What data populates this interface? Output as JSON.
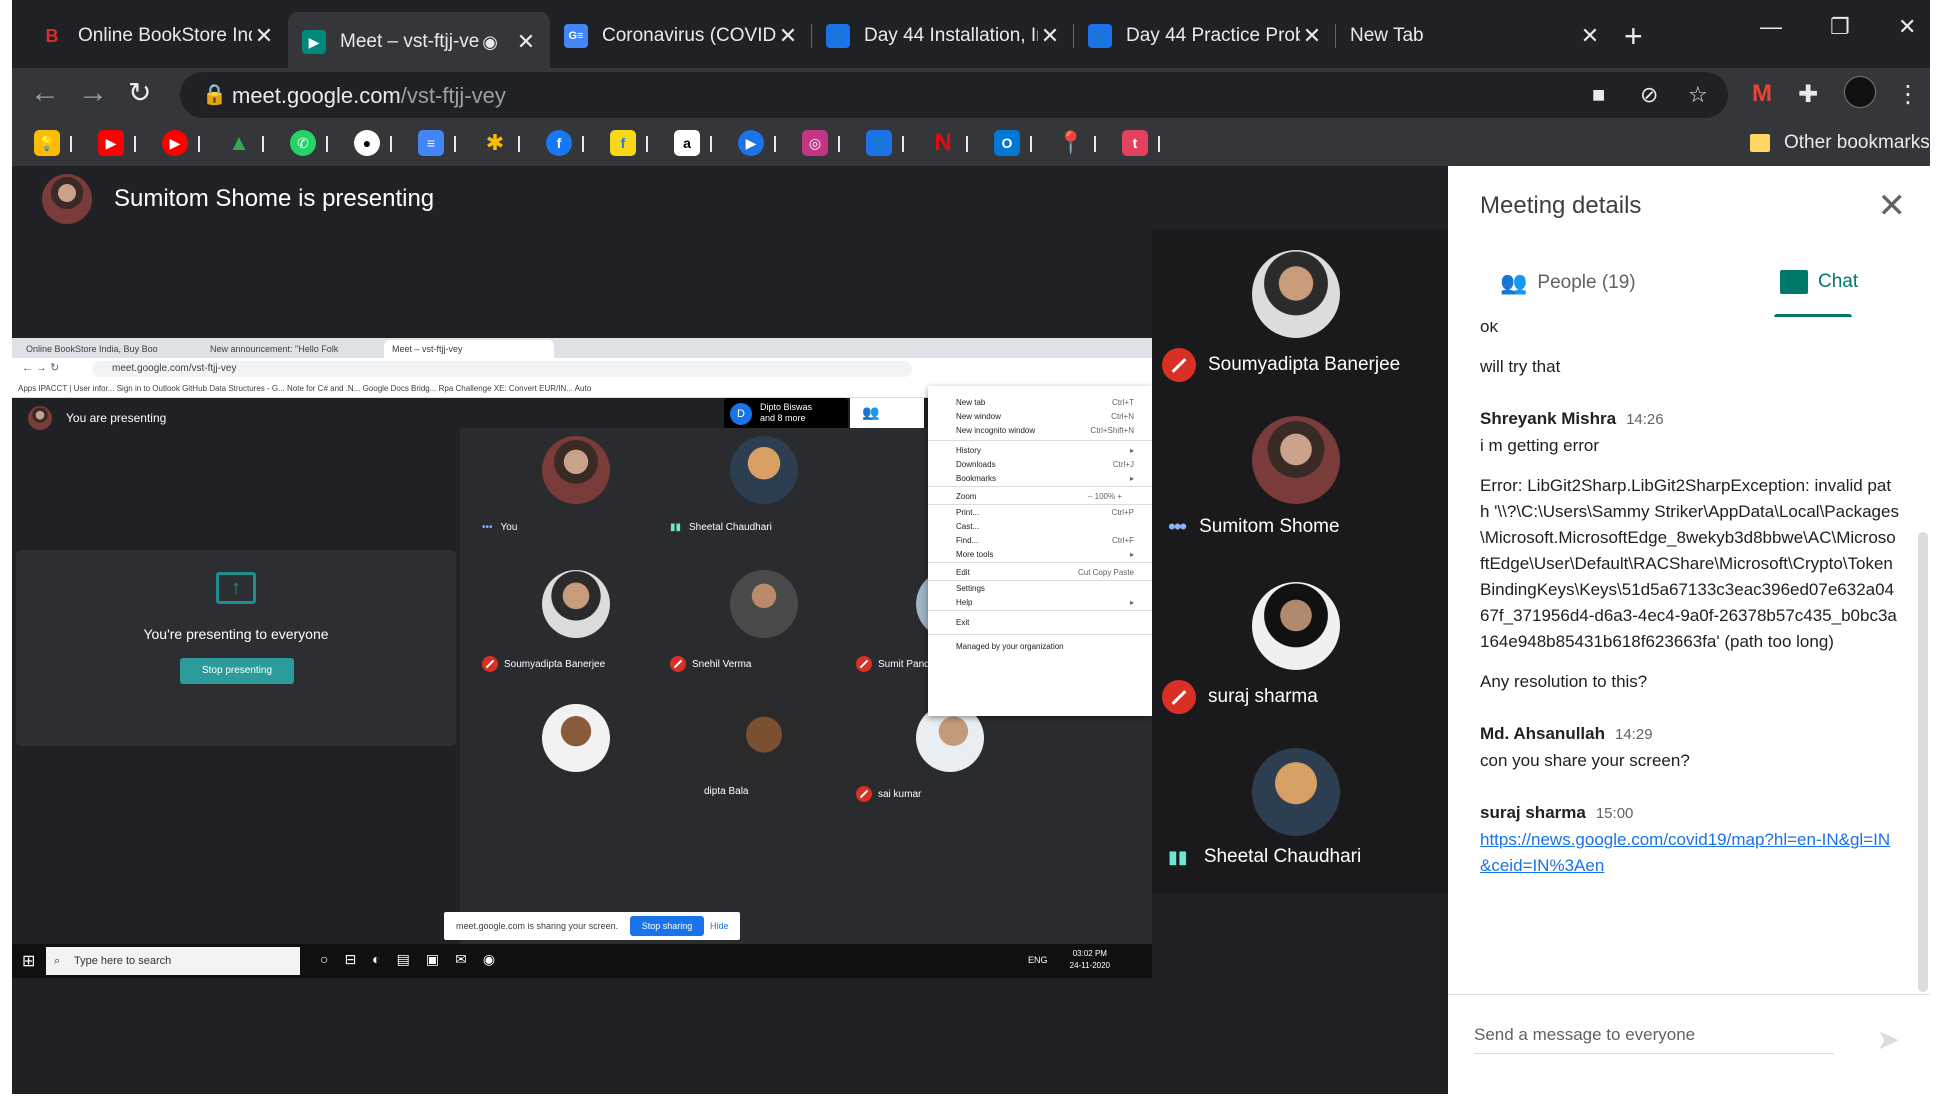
{
  "tabs": [
    {
      "title": "Online BookStore Ind",
      "favicon": "B",
      "fav_color": "#d32f2f",
      "active": false
    },
    {
      "title": "Meet – vst-ftjj-ve",
      "favicon": "M",
      "fav_color": "#00897b",
      "active": true
    },
    {
      "title": "Coronavirus (COVID-",
      "favicon": "G",
      "fav_color": "#4285f4",
      "active": false
    },
    {
      "title": "Day 44 Installation, Ir",
      "favicon": "C",
      "fav_color": "#1a73e8",
      "active": false
    },
    {
      "title": "Day 44 Practice Prob",
      "favicon": "C",
      "fav_color": "#1a73e8",
      "active": false
    },
    {
      "title": "New Tab",
      "favicon": "",
      "fav_color": "",
      "active": false
    }
  ],
  "address": {
    "domain": "meet.google.com",
    "path": "/vst-ftjj-vey"
  },
  "bookmarks": {
    "other_label": "Other bookmarks"
  },
  "presenter": {
    "label": "Sumitom Shome is presenting"
  },
  "shared_screen": {
    "tabs": [
      "Online BookStore India, Buy Boo",
      "New announcement: \"Hello Folk",
      "Meet – vst-ftjj-vey"
    ],
    "url": "meet.google.com/vst-ftjj-vey",
    "bookmarks_bar": "Apps   IPACCT | User infor...   Sign in to Outlook   GitHub   Data Structures - G...   Note for C# and .N...   Google Docs Bridg...   Rpa Challenge   XE: Convert EUR/IN...   Auto",
    "you_presenting": "You are presenting",
    "pill_name": "Dipto Biswas",
    "pill_more": "and 8 more",
    "presenting_text": "You're presenting to everyone",
    "stop_label": "Stop presenting",
    "participants": [
      {
        "name": "You",
        "state": "dots"
      },
      {
        "name": "Sheetal Chaudhari",
        "state": "speaking"
      },
      {
        "name": "Soumyadipta Banerjee",
        "state": "muted"
      },
      {
        "name": "Snehil Verma",
        "state": "muted"
      },
      {
        "name": "Sumit Pandit",
        "state": "muted"
      },
      {
        "name": "",
        "state": "none"
      },
      {
        "name": "dipta Bala",
        "state": "none"
      },
      {
        "name": "sai kumar",
        "state": "muted"
      }
    ],
    "menu": {
      "items": [
        {
          "label": "New tab",
          "shortcut": "Ctrl+T"
        },
        {
          "label": "New window",
          "shortcut": "Ctrl+N"
        },
        {
          "label": "New incognito window",
          "shortcut": "Ctrl+Shift+N"
        },
        {
          "label": "History",
          "shortcut": "▸"
        },
        {
          "label": "Downloads",
          "shortcut": "Ctrl+J"
        },
        {
          "label": "Bookmarks",
          "shortcut": "▸"
        },
        {
          "label": "Zoom",
          "shortcut": "–   100%   +"
        },
        {
          "label": "Print...",
          "shortcut": "Ctrl+P"
        },
        {
          "label": "Cast...",
          "shortcut": ""
        },
        {
          "label": "Find...",
          "shortcut": "Ctrl+F"
        },
        {
          "label": "More tools",
          "shortcut": "▸"
        },
        {
          "label": "Edit",
          "shortcut": "Cut   Copy   Paste"
        },
        {
          "label": "Settings",
          "shortcut": ""
        },
        {
          "label": "Help",
          "shortcut": "▸"
        },
        {
          "label": "Exit",
          "shortcut": ""
        },
        {
          "label": "Managed by your organization",
          "shortcut": ""
        }
      ]
    },
    "share_notice": "meet.google.com is sharing your screen.",
    "share_stop": "Stop sharing",
    "share_hide": "Hide",
    "taskbar_search": "Type here to search",
    "clock_time": "03:02 PM",
    "clock_date": "24-11-2020",
    "lang": "ENG"
  },
  "tiles": [
    {
      "name": "Soumyadipta Banerjee",
      "state": "muted"
    },
    {
      "name": "Sumitom Shome",
      "state": "dots"
    },
    {
      "name": "suraj sharma",
      "state": "muted"
    },
    {
      "name": "Sheetal Chaudhari",
      "state": "speaking"
    }
  ],
  "sidebar": {
    "title": "Meeting details",
    "people_label": "People (19)",
    "chat_label": "Chat",
    "messages": [
      {
        "sender": "",
        "time": "",
        "lines": [
          "ok"
        ]
      },
      {
        "sender": "",
        "time": "",
        "lines": [
          "will try that"
        ]
      },
      {
        "sender": "Shreyank Mishra",
        "time": "14:26",
        "lines": [
          "i m getting error",
          "Error: LibGit2Sharp.LibGit2SharpException: invalid path '\\\\?\\C:\\Users\\Sammy Striker\\AppData\\Local\\Packages\\Microsoft.MicrosoftEdge_8wekyb3d8bbwe\\AC\\MicrosoftEdge\\User\\Default\\RACShare\\Microsoft\\Crypto\\TokenBindingKeys\\Keys\\51d5a67133c3eac396ed07e632a0467f_371956d4-d6a3-4ec4-9a0f-26378b57c435_b0bc3a164e948b85431b618f623663fa' (path too long)",
          "Any resolution to this?"
        ]
      },
      {
        "sender": "Md. Ahsanullah",
        "time": "14:29",
        "lines": [
          "con you share your screen?"
        ]
      },
      {
        "sender": "suraj sharma",
        "time": "15:00",
        "link": "https://news.google.com/covid19/map?hl=en-IN&gl=IN&ceid=IN%3Aen"
      }
    ],
    "input_placeholder": "Send a message to everyone"
  }
}
